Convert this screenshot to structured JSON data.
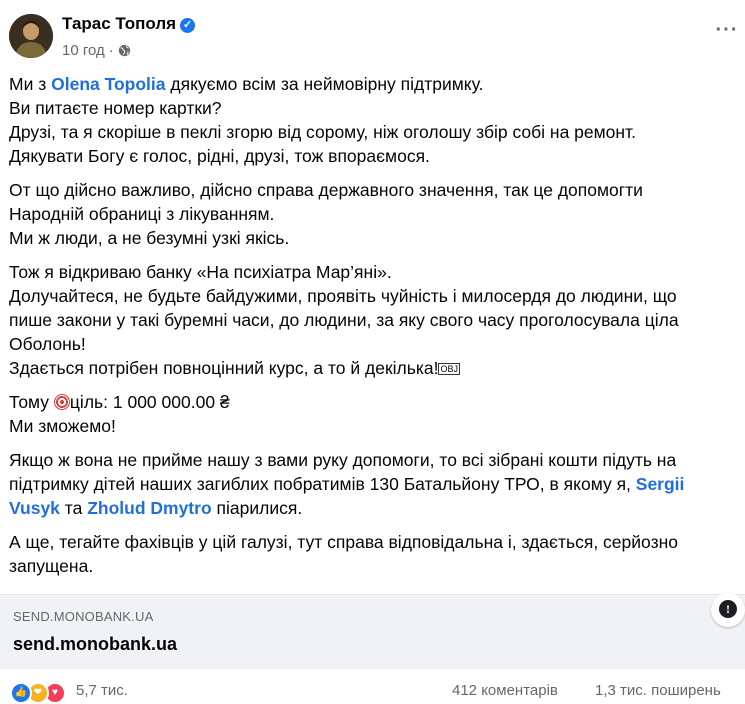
{
  "header": {
    "author": "Тарас Тополя",
    "time": "10 год",
    "globe_icon": "globe-icon",
    "verified_icon": "verified-badge-icon",
    "more_icon": "more-horizontal-icon"
  },
  "post": {
    "p1_pre": "Ми з ",
    "p1_mention": "Olena Topolia",
    "p1_post": " дякуємо всім за неймовірну підтримку.",
    "p1_l2": "Ви питаєте номер картки?",
    "p1_l3": "Друзі, та я скоріше в пеклі згорю від сорому, ніж оголошу збір собі на ремонт.",
    "p1_l4": "Дякувати Богу є голос, рідні, друзі, тож впораємося.",
    "p2_l1": "От що дійсно важливо, дійсно справа державного значення, так це допомогти",
    "p2_l2": "Народній обраниці з лікуванням.",
    "p2_l3": "Ми ж люди, а не безумні узкі якісь.",
    "p3_l1": "Тож я відкриваю банку «На психіатра Мар’яні».",
    "p3_l2": "Долучайтеся, не будьте байдужими, проявіть чуйність і милосердя до людини, що",
    "p3_l3": "пише закони у такі буремні часи, до людини, за яку свого часу проголосувала ціла",
    "p3_l4": "Оболонь!",
    "p3_l5": "Здається потрібен повноцінний курс, а то й декілька!",
    "obj_glyph": "OBJ",
    "p4_pre": "Тому ",
    "p4_post": "ціль: 1 000 000.00 ₴",
    "p4_l2": "Ми  зможемо!",
    "p5_l1": "Якщо ж вона не прийме нашу з вами руку допомоги, то всі зібрані кошти підуть на",
    "p5_l2_pre": "підтримку дітей наших загиблих побратимів 130 Батальйону ТРО, в якому я, ",
    "p5_mention1a": "Sergii",
    "p5_mention1b": "Vusyk",
    "p5_and": " та ",
    "p5_mention2": "Zholud Dmytro",
    "p5_end": " піарилися.",
    "p6_l1": "А ще, тегайте фахівців у цій галузі, тут справа відповідальна і, здається, серйозно",
    "p6_l2": "запущена.",
    "target_icon": "target-emoji-icon"
  },
  "link_preview": {
    "domain": "SEND.MONOBANK.UA",
    "title": "send.monobank.ua",
    "info_icon": "info-icon",
    "info_glyph": "!"
  },
  "stats": {
    "reactions_count": "5,7 тис.",
    "comments": "412 коментарів",
    "shares": "1,3 тис. поширень",
    "reaction_icons": [
      "like-icon",
      "care-icon",
      "love-icon"
    ]
  }
}
